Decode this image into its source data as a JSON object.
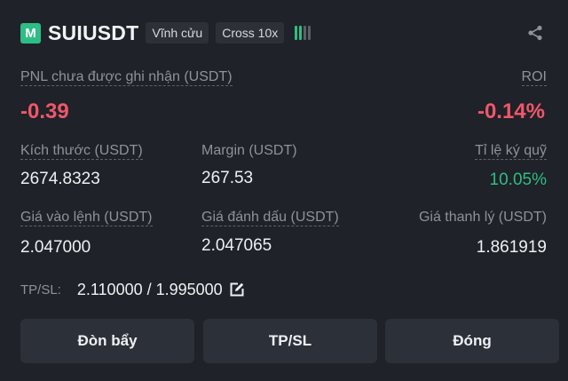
{
  "header": {
    "logo_letter": "M",
    "symbol": "SUIUSDT",
    "tags": [
      "Vĩnh cửu",
      "Cross 10x"
    ],
    "signal_icon": "signal-bars-icon",
    "share_icon": "share-icon"
  },
  "pnl": {
    "label": "PNL chưa được ghi nhận (USDT)",
    "value": "-0.39",
    "roi_label": "ROI",
    "roi_value": "-0.14%"
  },
  "row1": {
    "size_label": "Kích thước (USDT)",
    "size_value": "2674.8323",
    "margin_label": "Margin (USDT)",
    "margin_value": "267.53",
    "ratio_label": "Tỉ lệ ký quỹ",
    "ratio_value": "10.05%"
  },
  "row2": {
    "entry_label": "Giá vào lệnh (USDT)",
    "entry_value": "2.047000",
    "mark_label": "Giá đánh dấu (USDT)",
    "mark_value": "2.047065",
    "liq_label": "Giá thanh lý (USDT)",
    "liq_value": "1.861919"
  },
  "tpsl": {
    "label": "TP/SL:",
    "value": "2.110000 / 1.995000",
    "edit_icon": "edit-icon"
  },
  "buttons": {
    "leverage": "Đòn bẩy",
    "tpsl": "TP/SL",
    "close": "Đóng"
  },
  "colors": {
    "negative": "#f0576b",
    "positive": "#2ebd85",
    "background": "#1f2228",
    "button": "#2c3038"
  }
}
